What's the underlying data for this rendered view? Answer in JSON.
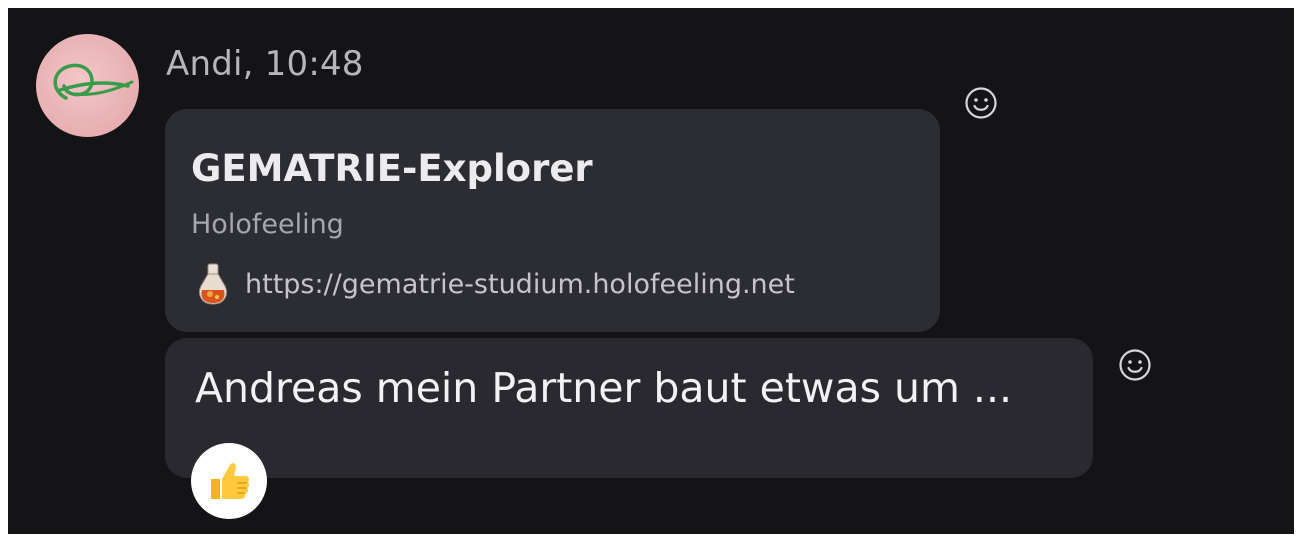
{
  "message_group": {
    "sender_name": "Andi",
    "time": "10:48",
    "header": "Andi, 10:48",
    "avatar_icon": "swirl-logo-icon"
  },
  "link_preview": {
    "title": "GEMATRIE-Explorer",
    "site_name": "Holofeeling",
    "url": "https://gematrie-studium.holofeeling.net",
    "favicon_icon": "potion-bottle-icon"
  },
  "message": {
    "text": "Andreas mein Partner baut etwas um ...",
    "reaction_emoji": "thumbs-up-icon"
  },
  "actions": {
    "add_reaction_icon": "smiley-icon"
  },
  "colors": {
    "background": "#141416",
    "bubble_link": "#2c2c33",
    "bubble_text": "#29292f",
    "avatar_bg": "#e7aeb1",
    "avatar_logo": "#3a9b4a"
  }
}
